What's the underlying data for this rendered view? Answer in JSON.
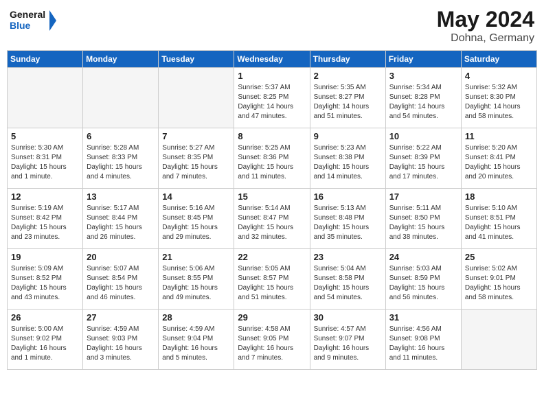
{
  "header": {
    "logo_line1": "General",
    "logo_line2": "Blue",
    "month": "May 2024",
    "location": "Dohna, Germany"
  },
  "weekdays": [
    "Sunday",
    "Monday",
    "Tuesday",
    "Wednesday",
    "Thursday",
    "Friday",
    "Saturday"
  ],
  "weeks": [
    [
      {
        "day": "",
        "empty": true
      },
      {
        "day": "",
        "empty": true
      },
      {
        "day": "",
        "empty": true
      },
      {
        "day": "1",
        "lines": [
          "Sunrise: 5:37 AM",
          "Sunset: 8:25 PM",
          "Daylight: 14 hours",
          "and 47 minutes."
        ]
      },
      {
        "day": "2",
        "lines": [
          "Sunrise: 5:35 AM",
          "Sunset: 8:27 PM",
          "Daylight: 14 hours",
          "and 51 minutes."
        ]
      },
      {
        "day": "3",
        "lines": [
          "Sunrise: 5:34 AM",
          "Sunset: 8:28 PM",
          "Daylight: 14 hours",
          "and 54 minutes."
        ]
      },
      {
        "day": "4",
        "lines": [
          "Sunrise: 5:32 AM",
          "Sunset: 8:30 PM",
          "Daylight: 14 hours",
          "and 58 minutes."
        ]
      }
    ],
    [
      {
        "day": "5",
        "lines": [
          "Sunrise: 5:30 AM",
          "Sunset: 8:31 PM",
          "Daylight: 15 hours",
          "and 1 minute."
        ]
      },
      {
        "day": "6",
        "lines": [
          "Sunrise: 5:28 AM",
          "Sunset: 8:33 PM",
          "Daylight: 15 hours",
          "and 4 minutes."
        ]
      },
      {
        "day": "7",
        "lines": [
          "Sunrise: 5:27 AM",
          "Sunset: 8:35 PM",
          "Daylight: 15 hours",
          "and 7 minutes."
        ]
      },
      {
        "day": "8",
        "lines": [
          "Sunrise: 5:25 AM",
          "Sunset: 8:36 PM",
          "Daylight: 15 hours",
          "and 11 minutes."
        ]
      },
      {
        "day": "9",
        "lines": [
          "Sunrise: 5:23 AM",
          "Sunset: 8:38 PM",
          "Daylight: 15 hours",
          "and 14 minutes."
        ]
      },
      {
        "day": "10",
        "lines": [
          "Sunrise: 5:22 AM",
          "Sunset: 8:39 PM",
          "Daylight: 15 hours",
          "and 17 minutes."
        ]
      },
      {
        "day": "11",
        "lines": [
          "Sunrise: 5:20 AM",
          "Sunset: 8:41 PM",
          "Daylight: 15 hours",
          "and 20 minutes."
        ]
      }
    ],
    [
      {
        "day": "12",
        "lines": [
          "Sunrise: 5:19 AM",
          "Sunset: 8:42 PM",
          "Daylight: 15 hours",
          "and 23 minutes."
        ]
      },
      {
        "day": "13",
        "lines": [
          "Sunrise: 5:17 AM",
          "Sunset: 8:44 PM",
          "Daylight: 15 hours",
          "and 26 minutes."
        ]
      },
      {
        "day": "14",
        "lines": [
          "Sunrise: 5:16 AM",
          "Sunset: 8:45 PM",
          "Daylight: 15 hours",
          "and 29 minutes."
        ]
      },
      {
        "day": "15",
        "lines": [
          "Sunrise: 5:14 AM",
          "Sunset: 8:47 PM",
          "Daylight: 15 hours",
          "and 32 minutes."
        ]
      },
      {
        "day": "16",
        "lines": [
          "Sunrise: 5:13 AM",
          "Sunset: 8:48 PM",
          "Daylight: 15 hours",
          "and 35 minutes."
        ]
      },
      {
        "day": "17",
        "lines": [
          "Sunrise: 5:11 AM",
          "Sunset: 8:50 PM",
          "Daylight: 15 hours",
          "and 38 minutes."
        ]
      },
      {
        "day": "18",
        "lines": [
          "Sunrise: 5:10 AM",
          "Sunset: 8:51 PM",
          "Daylight: 15 hours",
          "and 41 minutes."
        ]
      }
    ],
    [
      {
        "day": "19",
        "lines": [
          "Sunrise: 5:09 AM",
          "Sunset: 8:52 PM",
          "Daylight: 15 hours",
          "and 43 minutes."
        ]
      },
      {
        "day": "20",
        "lines": [
          "Sunrise: 5:07 AM",
          "Sunset: 8:54 PM",
          "Daylight: 15 hours",
          "and 46 minutes."
        ]
      },
      {
        "day": "21",
        "lines": [
          "Sunrise: 5:06 AM",
          "Sunset: 8:55 PM",
          "Daylight: 15 hours",
          "and 49 minutes."
        ]
      },
      {
        "day": "22",
        "lines": [
          "Sunrise: 5:05 AM",
          "Sunset: 8:57 PM",
          "Daylight: 15 hours",
          "and 51 minutes."
        ]
      },
      {
        "day": "23",
        "lines": [
          "Sunrise: 5:04 AM",
          "Sunset: 8:58 PM",
          "Daylight: 15 hours",
          "and 54 minutes."
        ]
      },
      {
        "day": "24",
        "lines": [
          "Sunrise: 5:03 AM",
          "Sunset: 8:59 PM",
          "Daylight: 15 hours",
          "and 56 minutes."
        ]
      },
      {
        "day": "25",
        "lines": [
          "Sunrise: 5:02 AM",
          "Sunset: 9:01 PM",
          "Daylight: 15 hours",
          "and 58 minutes."
        ]
      }
    ],
    [
      {
        "day": "26",
        "lines": [
          "Sunrise: 5:00 AM",
          "Sunset: 9:02 PM",
          "Daylight: 16 hours",
          "and 1 minute."
        ]
      },
      {
        "day": "27",
        "lines": [
          "Sunrise: 4:59 AM",
          "Sunset: 9:03 PM",
          "Daylight: 16 hours",
          "and 3 minutes."
        ]
      },
      {
        "day": "28",
        "lines": [
          "Sunrise: 4:59 AM",
          "Sunset: 9:04 PM",
          "Daylight: 16 hours",
          "and 5 minutes."
        ]
      },
      {
        "day": "29",
        "lines": [
          "Sunrise: 4:58 AM",
          "Sunset: 9:05 PM",
          "Daylight: 16 hours",
          "and 7 minutes."
        ]
      },
      {
        "day": "30",
        "lines": [
          "Sunrise: 4:57 AM",
          "Sunset: 9:07 PM",
          "Daylight: 16 hours",
          "and 9 minutes."
        ]
      },
      {
        "day": "31",
        "lines": [
          "Sunrise: 4:56 AM",
          "Sunset: 9:08 PM",
          "Daylight: 16 hours",
          "and 11 minutes."
        ]
      },
      {
        "day": "",
        "empty": true
      }
    ]
  ]
}
